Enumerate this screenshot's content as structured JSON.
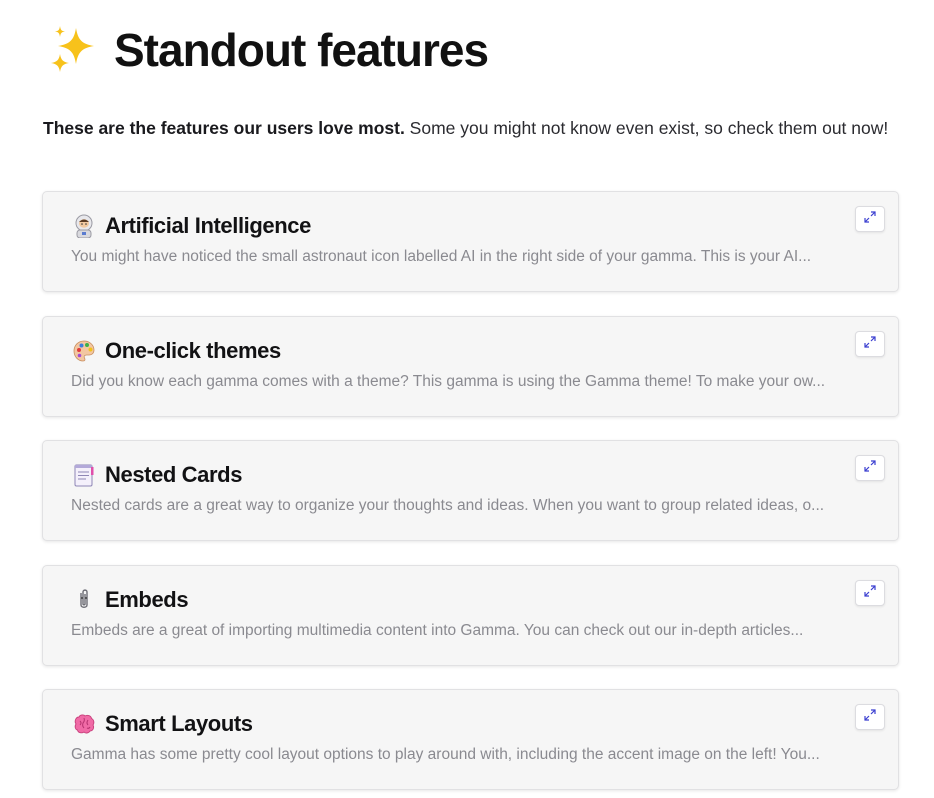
{
  "header": {
    "title": "Standout features",
    "icon": "sparkles-icon"
  },
  "intro": {
    "bold": "These are the features our users love most.",
    "rest": " Some you might not know even exist, so check them out now!"
  },
  "cards": [
    {
      "icon": "astronaut-icon",
      "title": "Artificial Intelligence",
      "description": "You might have noticed the small astronaut icon labelled AI in the right side of your gamma. This is your AI..."
    },
    {
      "icon": "palette-icon",
      "title": "One-click themes",
      "description": "Did you know each gamma comes with a theme? This gamma is using the Gamma theme! To make your ow..."
    },
    {
      "icon": "notepad-icon",
      "title": "Nested Cards",
      "description": "Nested cards are a great way to organize your thoughts and ideas. When you want to group related ideas, o..."
    },
    {
      "icon": "paperclip-icon",
      "title": "Embeds",
      "description": "Embeds are a great of importing multimedia content into Gamma. You can check out our in-depth articles..."
    },
    {
      "icon": "brain-icon",
      "title": "Smart Layouts",
      "description": "Gamma has some pretty cool layout options to play around with, including the accent image on the left! You..."
    }
  ],
  "colors": {
    "card_bg": "#f6f6f6",
    "description_text": "#8a8a90",
    "expand_icon": "#3b3fd0"
  }
}
